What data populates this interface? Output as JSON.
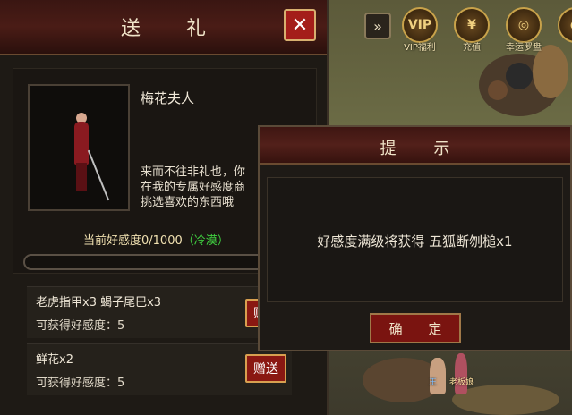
{
  "window": {
    "title": "送 礼"
  },
  "top_bar": {
    "expand_icon": "double-chevron-right",
    "items": [
      {
        "label": "VIP福利",
        "glyph": "VIP"
      },
      {
        "label": "充值",
        "glyph": "¥"
      },
      {
        "label": "幸运罗盘",
        "glyph": "◎"
      },
      {
        "label": "",
        "glyph": "◐"
      }
    ]
  },
  "npc": {
    "name": "梅花夫人",
    "description": "来而不往非礼也，你\n在我的专属好感度商\n挑选喜欢的东西哦",
    "affinity_label": "当前好感度0/1000",
    "affinity_status": "（冷漠）",
    "affinity_progress": 0
  },
  "gifts": [
    {
      "name": "老虎指甲x3 蝎子尾巴x3",
      "points": "可获得好感度：5",
      "button": "赠送"
    },
    {
      "name": "鲜花x2",
      "points": "可获得好感度：5",
      "button": "赠送"
    }
  ],
  "dialog": {
    "title": "提 示",
    "message": "好感度满级将获得 五狐断刎槌x1",
    "confirm": "确 定"
  },
  "scene_labels": {
    "npc1": "王",
    "npc2": "老板娘"
  },
  "colors": {
    "accent": "#a41e1a",
    "gold": "#c8a24a",
    "status_green": "#40d040"
  }
}
